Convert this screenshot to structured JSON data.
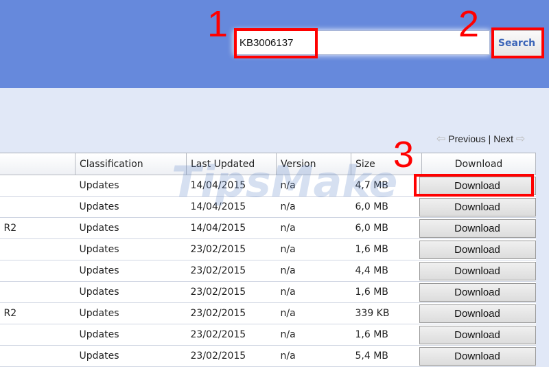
{
  "search": {
    "value": "KB3006137",
    "button": "Search"
  },
  "annotations": [
    "1",
    "2",
    "3"
  ],
  "pager": {
    "previous": "Previous",
    "separator": "|",
    "next": "Next"
  },
  "table": {
    "columns": [
      "",
      "Classification",
      "Last Updated",
      "Version",
      "Size",
      "Download"
    ],
    "rows": [
      {
        "title": "",
        "classification": "Updates",
        "date": "14/04/2015",
        "version": "n/a",
        "size": "4,7 MB",
        "action": "Download"
      },
      {
        "title": "",
        "classification": "Updates",
        "date": "14/04/2015",
        "version": "n/a",
        "size": "6,0 MB",
        "action": "Download"
      },
      {
        "title": "R2",
        "classification": "Updates",
        "date": "14/04/2015",
        "version": "n/a",
        "size": "6,0 MB",
        "action": "Download"
      },
      {
        "title": "",
        "classification": "Updates",
        "date": "23/02/2015",
        "version": "n/a",
        "size": "1,6 MB",
        "action": "Download"
      },
      {
        "title": "",
        "classification": "Updates",
        "date": "23/02/2015",
        "version": "n/a",
        "size": "4,4 MB",
        "action": "Download"
      },
      {
        "title": "",
        "classification": "Updates",
        "date": "23/02/2015",
        "version": "n/a",
        "size": "1,6 MB",
        "action": "Download"
      },
      {
        "title": "R2",
        "classification": "Updates",
        "date": "23/02/2015",
        "version": "n/a",
        "size": "339 KB",
        "action": "Download"
      },
      {
        "title": "",
        "classification": "Updates",
        "date": "23/02/2015",
        "version": "n/a",
        "size": "1,6 MB",
        "action": "Download"
      },
      {
        "title": "",
        "classification": "Updates",
        "date": "23/02/2015",
        "version": "n/a",
        "size": "5,4 MB",
        "action": "Download"
      }
    ]
  },
  "watermark": "TipsMake"
}
